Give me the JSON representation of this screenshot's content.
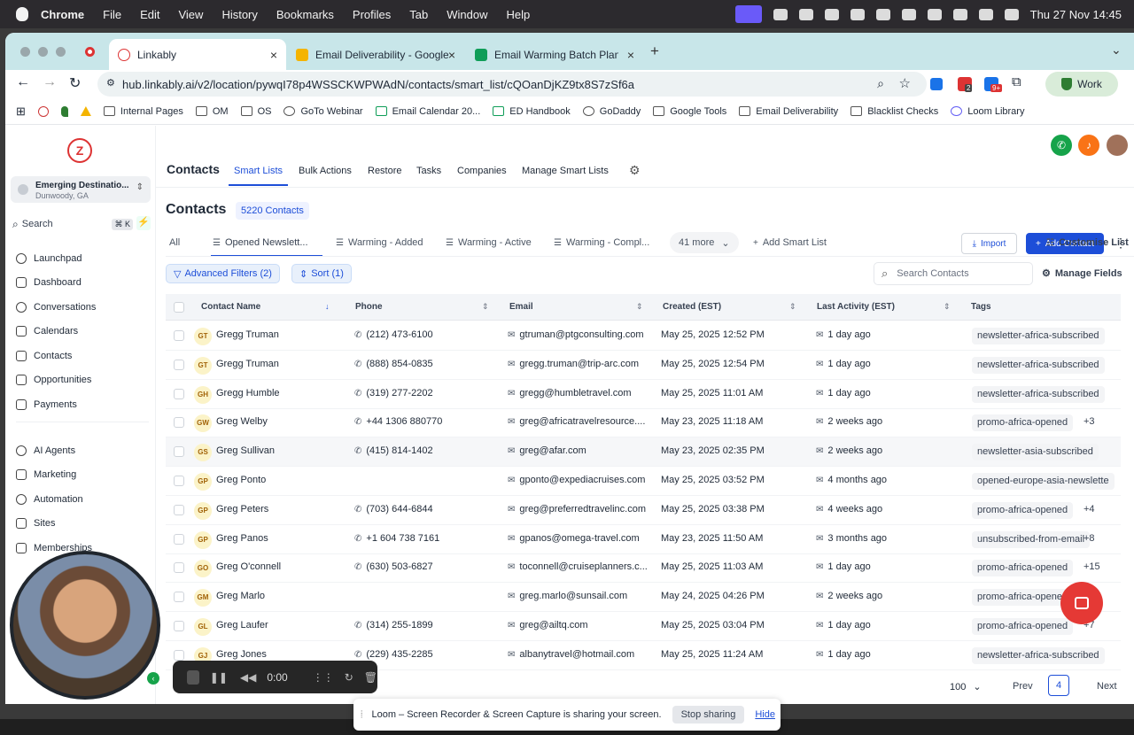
{
  "menubar": {
    "app": "Chrome",
    "items": [
      "File",
      "Edit",
      "View",
      "History",
      "Bookmarks",
      "Profiles",
      "Tab",
      "Window",
      "Help"
    ],
    "datetime": "Thu 27 Nov  14:45"
  },
  "tabs": [
    {
      "label": "Linkably",
      "active": true
    },
    {
      "label": "Email Deliverability - Google D"
    },
    {
      "label": "Email Warming Batch Planning"
    }
  ],
  "url": "hub.linkably.ai/v2/location/pywqI78p4WSSCKWPWAdN/contacts/smart_list/cQOanDjKZ9tx8S7zSf6a",
  "profile": "Work",
  "ext_badges": [
    "2",
    "9+"
  ],
  "bookmarks": [
    "Internal Pages",
    "OM",
    "OS",
    "GoTo Webinar",
    "Email Calendar 20...",
    "ED Handbook",
    "GoDaddy",
    "Google Tools",
    "Email Deliverability",
    "Blacklist Checks",
    "Loom Library"
  ],
  "sidebar": {
    "logo": "Z",
    "location": {
      "name": "Emerging Destinatio...",
      "city": "Dunwoody, GA"
    },
    "search": "Search",
    "shortcut": "⌘ K",
    "items": [
      "Launchpad",
      "Dashboard",
      "Conversations",
      "Calendars",
      "Contacts",
      "Opportunities",
      "Payments"
    ],
    "items2": [
      "AI Agents",
      "Marketing",
      "Automation",
      "Sites",
      "Memberships"
    ]
  },
  "topnav": {
    "title": "Contacts",
    "items": [
      "Smart Lists",
      "Bulk Actions",
      "Restore",
      "Tasks",
      "Companies",
      "Manage Smart Lists"
    ]
  },
  "header": {
    "title": "Contacts",
    "count": "5220 Contacts",
    "import": "Import",
    "add": "Add Contact"
  },
  "subtabs": [
    "All",
    "Opened Newslett...",
    "Warming - Added",
    "Warming - Active",
    "Warming - Compl...",
    "41 more",
    "Add Smart List",
    "Customise List"
  ],
  "filters": {
    "advanced": "Advanced Filters (2)",
    "sort": "Sort (1)",
    "search_placeholder": "Search Contacts",
    "manage": "Manage Fields"
  },
  "columns": [
    "Contact Name",
    "Phone",
    "Email",
    "Created (EST)",
    "Last Activity (EST)",
    "Tags"
  ],
  "rows": [
    {
      "initials": "GT",
      "name": "Gregg Truman",
      "phone": "(212) 473-6100",
      "email": "gtruman@ptgconsulting.com",
      "created": "May 25, 2025 12:52 PM",
      "activity": "1 day ago",
      "tag": "newsletter-africa-subscribed",
      "more": ""
    },
    {
      "initials": "GT",
      "name": "Gregg Truman",
      "phone": "(888) 854-0835",
      "email": "gregg.truman@trip-arc.com",
      "created": "May 25, 2025 12:54 PM",
      "activity": "1 day ago",
      "tag": "newsletter-africa-subscribed",
      "more": ""
    },
    {
      "initials": "GH",
      "name": "Gregg Humble",
      "phone": "(319) 277-2202",
      "email": "gregg@humbletravel.com",
      "created": "May 25, 2025 11:01 AM",
      "activity": "1 day ago",
      "tag": "newsletter-africa-subscribed",
      "more": ""
    },
    {
      "initials": "GW",
      "name": "Greg Welby",
      "phone": "+44 1306 880770",
      "email": "greg@africatravelresource....",
      "created": "May 23, 2025 11:18 AM",
      "activity": "2 weeks ago",
      "tag": "promo-africa-opened",
      "more": "+3"
    },
    {
      "initials": "GS",
      "name": "Greg Sullivan",
      "phone": "(415) 814-1402",
      "email": "greg@afar.com",
      "created": "May 23, 2025 02:35 PM",
      "activity": "2 weeks ago",
      "tag": "newsletter-asia-subscribed",
      "more": ""
    },
    {
      "initials": "GP",
      "name": "Greg Ponto",
      "phone": "",
      "email": "gponto@expediacruises.com",
      "created": "May 25, 2025 03:52 PM",
      "activity": "4 months ago",
      "tag": "opened-europe-asia-newslette",
      "more": ""
    },
    {
      "initials": "GP",
      "name": "Greg Peters",
      "phone": "(703) 644-6844",
      "email": "greg@preferredtravelinc.com",
      "created": "May 25, 2025 03:38 PM",
      "activity": "4 weeks ago",
      "tag": "promo-africa-opened",
      "more": "+4"
    },
    {
      "initials": "GP",
      "name": "Greg Panos",
      "phone": "+1 604 738 7161",
      "email": "gpanos@omega-travel.com",
      "created": "May 23, 2025 11:50 AM",
      "activity": "3 months ago",
      "tag": "unsubscribed-from-email",
      "more": "+8"
    },
    {
      "initials": "GO",
      "name": "Greg O'connell",
      "phone": "(630) 503-6827",
      "email": "toconnell@cruiseplanners.c...",
      "created": "May 25, 2025 11:03 AM",
      "activity": "1 day ago",
      "tag": "promo-africa-opened",
      "more": "+15"
    },
    {
      "initials": "GM",
      "name": "Greg Marlo",
      "phone": "",
      "email": "greg.marlo@sunsail.com",
      "created": "May 24, 2025 04:26 PM",
      "activity": "2 weeks ago",
      "tag": "promo-africa-opened",
      "more": ""
    },
    {
      "initials": "GL",
      "name": "Greg Laufer",
      "phone": "(314) 255-1899",
      "email": "greg@ailtq.com",
      "created": "May 25, 2025 03:04 PM",
      "activity": "1 day ago",
      "tag": "promo-africa-opened",
      "more": "+7"
    },
    {
      "initials": "GJ",
      "name": "Greg Jones",
      "phone": "(229) 435-2285",
      "email": "albanytravel@hotmail.com",
      "created": "May 25, 2025 11:24 AM",
      "activity": "1 day ago",
      "tag": "newsletter-africa-subscribed",
      "more": ""
    }
  ],
  "pagination": {
    "per_page": "100",
    "prev": "Prev",
    "page": "4",
    "next": "Next"
  },
  "loom": {
    "message": "Loom – Screen Recorder & Screen Capture is sharing your screen.",
    "stop": "Stop sharing",
    "hide": "Hide"
  },
  "recorder": {
    "time": "0:00"
  },
  "colors": {
    "accent": "#1d4ed8",
    "tabbar": "#c8e6e9",
    "fab": "#e53935"
  }
}
